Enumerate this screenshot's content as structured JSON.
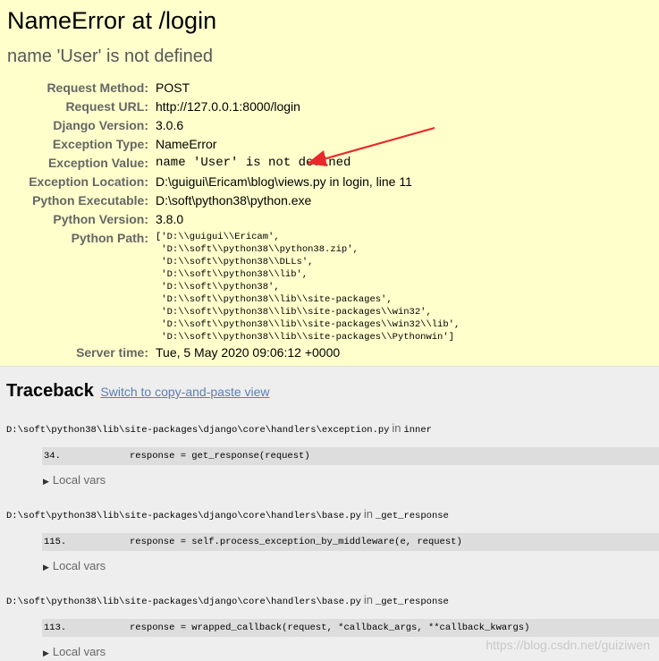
{
  "summary": {
    "title": "NameError at /login",
    "exception_message": "name 'User' is not defined",
    "meta": [
      {
        "label": "Request Method:",
        "value": "POST"
      },
      {
        "label": "Request URL:",
        "value": "http://127.0.0.1:8000/login"
      },
      {
        "label": "Django Version:",
        "value": "3.0.6"
      },
      {
        "label": "Exception Type:",
        "value": "NameError"
      },
      {
        "label": "Exception Value:",
        "value": "name 'User' is not defined"
      },
      {
        "label": "Exception Location:",
        "value": "D:\\guigui\\Ericam\\blog\\views.py in login, line 11"
      },
      {
        "label": "Python Executable:",
        "value": "D:\\soft\\python38\\python.exe"
      },
      {
        "label": "Python Version:",
        "value": "3.8.0"
      },
      {
        "label": "Python Path:",
        "value": "['D:\\\\guigui\\\\Ericam',\n 'D:\\\\soft\\\\python38\\\\python38.zip',\n 'D:\\\\soft\\\\python38\\\\DLLs',\n 'D:\\\\soft\\\\python38\\\\lib',\n 'D:\\\\soft\\\\python38',\n 'D:\\\\soft\\\\python38\\\\lib\\\\site-packages',\n 'D:\\\\soft\\\\python38\\\\lib\\\\site-packages\\\\win32',\n 'D:\\\\soft\\\\python38\\\\lib\\\\site-packages\\\\win32\\\\lib',\n 'D:\\\\soft\\\\python38\\\\lib\\\\site-packages\\\\Pythonwin']"
      },
      {
        "label": "Server time:",
        "value": "Tue, 5 May 2020 09:06:12 +0000"
      }
    ]
  },
  "traceback": {
    "heading": "Traceback",
    "switch_link": "Switch to copy-and-paste view",
    "in_word": "in",
    "frames": [
      {
        "file": "D:\\soft\\python38\\lib\\site-packages\\django\\core\\handlers\\exception.py",
        "function": "inner",
        "line_no": "34.",
        "code": "response = get_response(request)",
        "local_vars": "Local vars"
      },
      {
        "file": "D:\\soft\\python38\\lib\\site-packages\\django\\core\\handlers\\base.py",
        "function": "_get_response",
        "line_no": "115.",
        "code": "response = self.process_exception_by_middleware(e, request)",
        "local_vars": "Local vars"
      },
      {
        "file": "D:\\soft\\python38\\lib\\site-packages\\django\\core\\handlers\\base.py",
        "function": "_get_response",
        "line_no": "113.",
        "code": "response = wrapped_callback(request, *callback_args, **callback_kwargs)",
        "local_vars": "Local vars"
      }
    ]
  },
  "watermark": "https://blog.csdn.net/guiziwen",
  "colors": {
    "summary_bg": "#ffffcc",
    "traceback_bg": "#eeeeee",
    "code_bg": "#dddddd",
    "link": "#5b80b2",
    "arrow": "#e8282b"
  }
}
